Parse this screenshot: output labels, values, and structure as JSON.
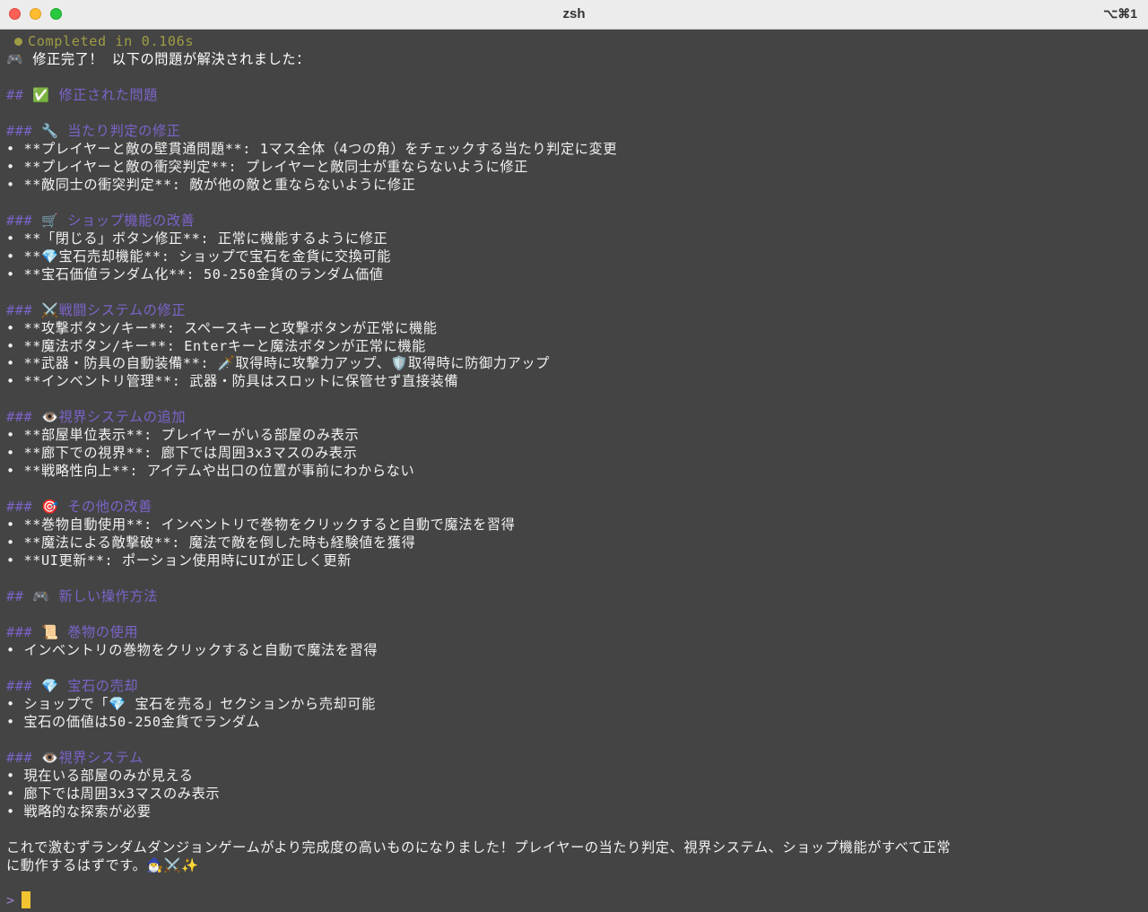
{
  "window": {
    "title": "zsh",
    "shortcut": "⌥⌘1"
  },
  "terminal": {
    "status": "Completed in 0.106s",
    "lines": [
      "🎮 修正完了！ 以下の問題が解決されました：",
      "",
      "## ✅ 修正された問題",
      "",
      "### 🔧 当たり判定の修正",
      "• **プレイヤーと敵の壁貫通問題**: 1マス全体（4つの角）をチェックする当たり判定に変更",
      "• **プレイヤーと敵の衝突判定**: プレイヤーと敵同士が重ならないように修正",
      "• **敵同士の衝突判定**: 敵が他の敵と重ならないように修正",
      "",
      "### 🛒 ショップ機能の改善",
      "• **「閉じる」ボタン修正**: 正常に機能するように修正",
      "• **💎宝石売却機能**: ショップで宝石を金貨に交換可能",
      "• **宝石価値ランダム化**: 50-250金貨のランダム価値",
      "",
      "### ⚔️戦闘システムの修正",
      "• **攻撃ボタン/キー**: スペースキーと攻撃ボタンが正常に機能",
      "• **魔法ボタン/キー**: Enterキーと魔法ボタンが正常に機能",
      "• **武器・防具の自動装備**: 🗡️取得時に攻撃力アップ、🛡️取得時に防御力アップ",
      "• **インベントリ管理**: 武器・防具はスロットに保管せず直接装備",
      "",
      "### 👁️視界システムの追加",
      "• **部屋単位表示**: プレイヤーがいる部屋のみ表示",
      "• **廊下での視界**: 廊下では周囲3x3マスのみ表示",
      "• **戦略性向上**: アイテムや出口の位置が事前にわからない",
      "",
      "### 🎯 その他の改善",
      "• **巻物自動使用**: インベントリで巻物をクリックすると自動で魔法を習得",
      "• **魔法による敵撃破**: 魔法で敵を倒した時も経験値を獲得",
      "• **UI更新**: ポーション使用時にUIが正しく更新",
      "",
      "## 🎮 新しい操作方法",
      "",
      "### 📜 巻物の使用",
      "• インベントリの巻物をクリックすると自動で魔法を習得",
      "",
      "### 💎 宝石の売却",
      "• ショップで「💎 宝石を売る」セクションから売却可能",
      "• 宝石の価値は50-250金貨でランダム",
      "",
      "### 👁️視界システム",
      "• 現在いる部屋のみが見える",
      "• 廊下では周囲3x3マスのみ表示",
      "• 戦略的な探索が必要",
      "",
      "これで激むずランダムダンジョンゲームがより完成度の高いものになりました！プレイヤーの当たり判定、視界システム、ショップ機能がすべて正常",
      "に動作するはずです。🧙‍♂️⚔️✨"
    ],
    "prompt": ">"
  },
  "colors": {
    "background": "#444444",
    "heading": "#7c63c9",
    "status": "#9f9d44",
    "cursor": "#f4c430"
  }
}
